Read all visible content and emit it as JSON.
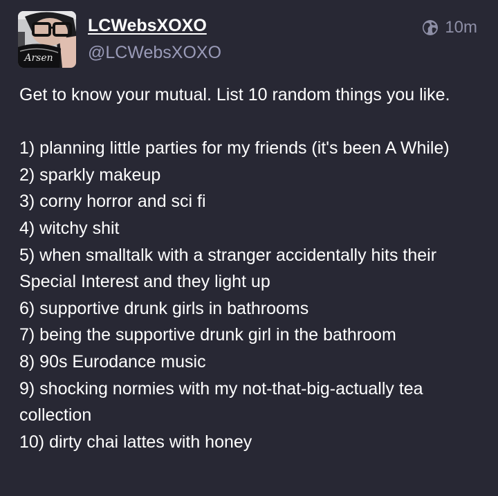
{
  "post": {
    "author": {
      "display_name": "LCWebsXOXO",
      "handle": "@LCWebsXOXO",
      "avatar_text": "Arsen"
    },
    "visibility_icon": "globe-icon",
    "timestamp": "10m",
    "body": "Get to know your mutual. List 10 random things you like.\n\n1)  planning little parties for my friends (it's been A While)\n2)  sparkly makeup\n3)  corny horror and sci fi\n4)  witchy shit\n5)  when smalltalk with a stranger accidentally hits their Special Interest and they light up\n6)  supportive drunk girls in bathrooms\n7)  being the supportive drunk girl in the bathroom\n8)  90s Eurodance music\n9)  shocking normies with my not-that-big-actually tea collection\n10) dirty chai lattes with honey"
  },
  "colors": {
    "background": "#282834",
    "text": "#ffffff",
    "handle": "#9a9bb8",
    "meta": "#8e8fa6"
  }
}
